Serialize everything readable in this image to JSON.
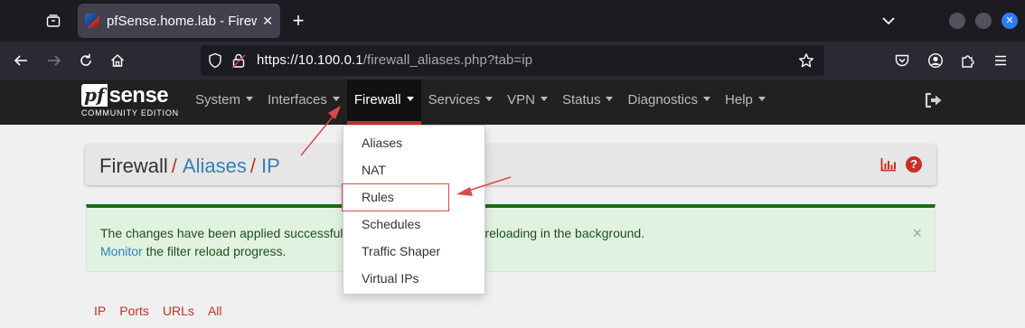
{
  "browser": {
    "tab_title": "pfSense.home.lab - Firewall",
    "tab_close": "✕",
    "new_tab": "+",
    "url_host": "https://10.100.0.1",
    "url_path": "/firewall_aliases.php?tab=ip",
    "window_close": "✕"
  },
  "pfsense": {
    "logo_pf": "pf",
    "logo_sense": "sense",
    "logo_edition": "COMMUNITY EDITION",
    "menu": [
      {
        "label": "System"
      },
      {
        "label": "Interfaces"
      },
      {
        "label": "Firewall"
      },
      {
        "label": "Services"
      },
      {
        "label": "VPN"
      },
      {
        "label": "Status"
      },
      {
        "label": "Diagnostics"
      },
      {
        "label": "Help"
      }
    ],
    "firewall_dropdown": [
      {
        "label": "Aliases"
      },
      {
        "label": "NAT"
      },
      {
        "label": "Rules"
      },
      {
        "label": "Schedules"
      },
      {
        "label": "Traffic Shaper"
      },
      {
        "label": "Virtual IPs"
      }
    ]
  },
  "page": {
    "breadcrumb": [
      "Firewall",
      "Aliases",
      "IP"
    ],
    "breadcrumb_separator": "/",
    "help_icon": "?",
    "alert": {
      "line1_visible": "The changes have been applied successfull",
      "line1_tail": "ow reloading in the background.",
      "line2_link": "Monitor",
      "line2_rest": " the filter reload progress.",
      "close": "×"
    },
    "subtabs": [
      {
        "label": "IP"
      },
      {
        "label": "Ports"
      },
      {
        "label": "URLs"
      },
      {
        "label": "All"
      }
    ]
  },
  "colors": {
    "accent_red": "#ca2f24",
    "link_blue": "#3280b8",
    "success_green": "#1e6b1e",
    "annotation_red": "#e0474b"
  },
  "icons": [
    "tab-list-icon",
    "back-icon",
    "forward-icon",
    "reload-icon",
    "home-icon",
    "shield-icon",
    "lock-icon",
    "bookmark-star-icon",
    "pocket-icon",
    "account-icon",
    "extensions-icon",
    "hamburger-menu-icon",
    "logout-icon",
    "chart-icon",
    "help-icon",
    "annotation-arrow-icon"
  ]
}
